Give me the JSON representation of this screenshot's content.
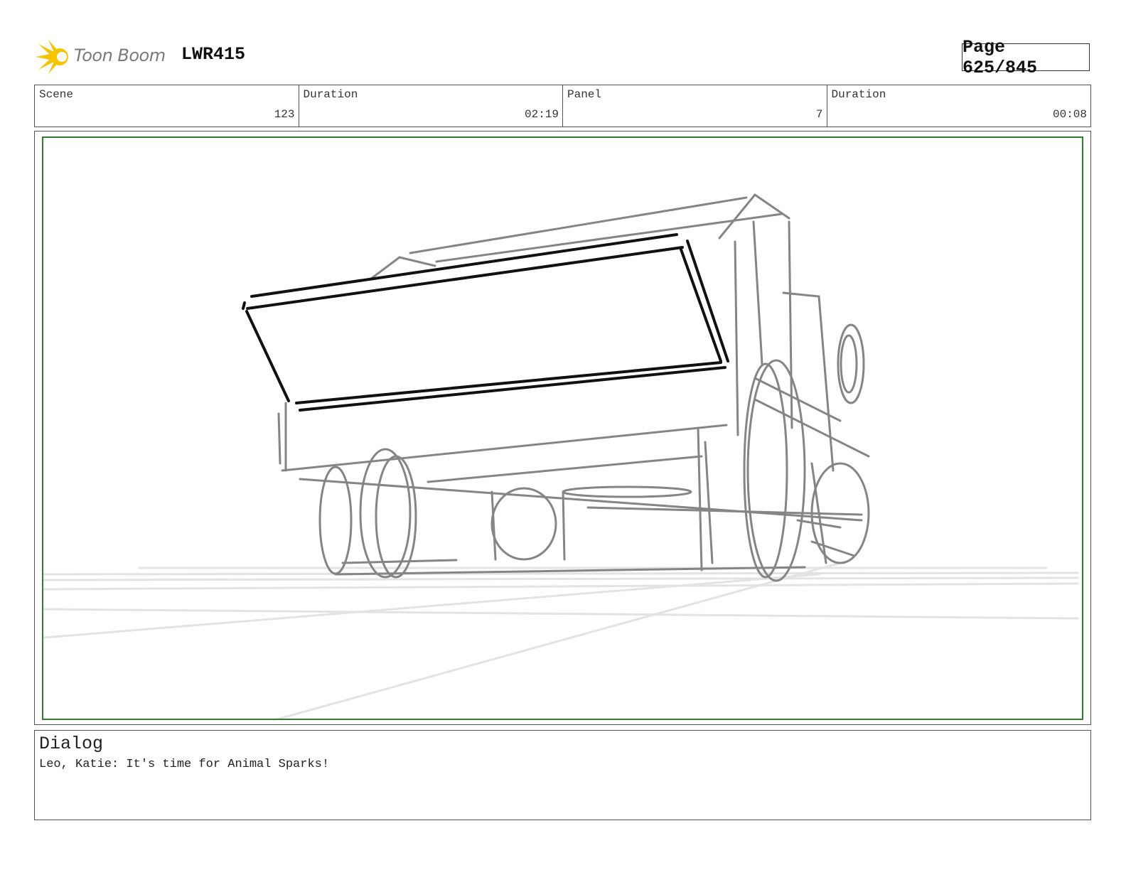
{
  "header": {
    "logo_text": "Toon Boom",
    "project_code": "LWR415",
    "page_label": "Page 625/845"
  },
  "info": [
    {
      "label": "Scene",
      "value": "123"
    },
    {
      "label": "Duration",
      "value": "02:19"
    },
    {
      "label": "Panel",
      "value": "7"
    },
    {
      "label": "Duration",
      "value": "00:08"
    }
  ],
  "dialog": {
    "title": "Dialog",
    "text": "Leo, Katie: It's time for Animal Sparks!"
  },
  "colors": {
    "panel_border": "#2e7d32",
    "logo_accent": "#f5c400",
    "sketch_gray": "#808080",
    "sketch_black": "#111111"
  }
}
